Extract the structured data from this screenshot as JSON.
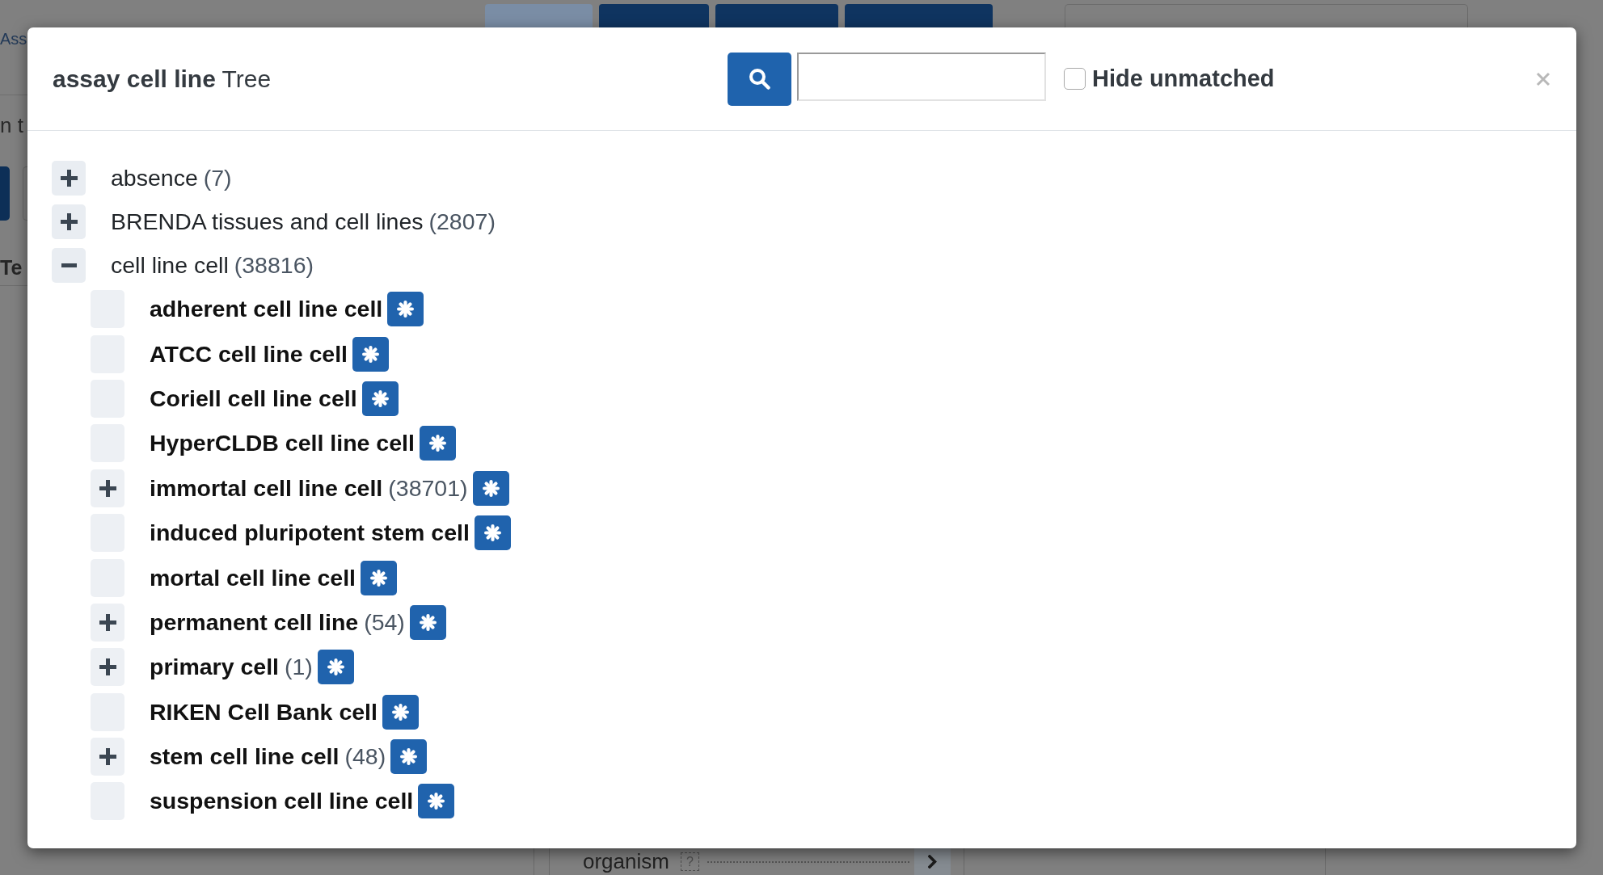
{
  "background": {
    "toolbar_buttons": [
      {
        "disabled": true
      },
      {
        "disabled": false
      },
      {
        "disabled": false
      },
      {
        "disabled": false
      }
    ],
    "heading_fragment": "Ass",
    "text_fragment": "n t",
    "tab_fragment": "Te",
    "field": {
      "label": "organism",
      "help": "?"
    }
  },
  "modal": {
    "title": "**assay cell line** Tree",
    "hide_unmatched": {
      "label": "Hide unmatched",
      "checked": false
    },
    "tree": [
      {
        "label": "absence",
        "count": "(7)",
        "kind": "branch",
        "expanded": false,
        "wildcard": false
      },
      {
        "label": "BRENDA tissues and cell lines",
        "count": "(2807)",
        "kind": "branch",
        "expanded": false,
        "wildcard": false
      },
      {
        "label": "cell line cell",
        "count": "(38816)",
        "kind": "branch",
        "expanded": true,
        "wildcard": false,
        "children": [
          {
            "label": "adherent cell line cell",
            "kind": "leaf",
            "wildcard": true
          },
          {
            "label": "ATCC cell line cell",
            "kind": "leaf",
            "wildcard": true
          },
          {
            "label": "Coriell cell line cell",
            "kind": "leaf",
            "wildcard": true
          },
          {
            "label": "HyperCLDB cell line cell",
            "kind": "leaf",
            "wildcard": true
          },
          {
            "label": "immortal cell line cell",
            "count": "(38701)",
            "kind": "branch",
            "expanded": false,
            "wildcard": true
          },
          {
            "label": "induced pluripotent stem cell",
            "kind": "leaf",
            "wildcard": true
          },
          {
            "label": "mortal cell line cell",
            "kind": "leaf",
            "wildcard": true
          },
          {
            "label": "permanent cell line",
            "count": "(54)",
            "kind": "branch",
            "expanded": false,
            "wildcard": true
          },
          {
            "label": "primary cell",
            "count": "(1)",
            "kind": "branch",
            "expanded": false,
            "wildcard": true
          },
          {
            "label": "RIKEN Cell Bank cell",
            "kind": "leaf",
            "wildcard": true
          },
          {
            "label": "stem cell line cell",
            "count": "(48)",
            "kind": "branch",
            "expanded": false,
            "wildcard": true
          },
          {
            "label": "suspension cell line cell",
            "kind": "leaf",
            "wildcard": true
          }
        ]
      }
    ]
  }
}
